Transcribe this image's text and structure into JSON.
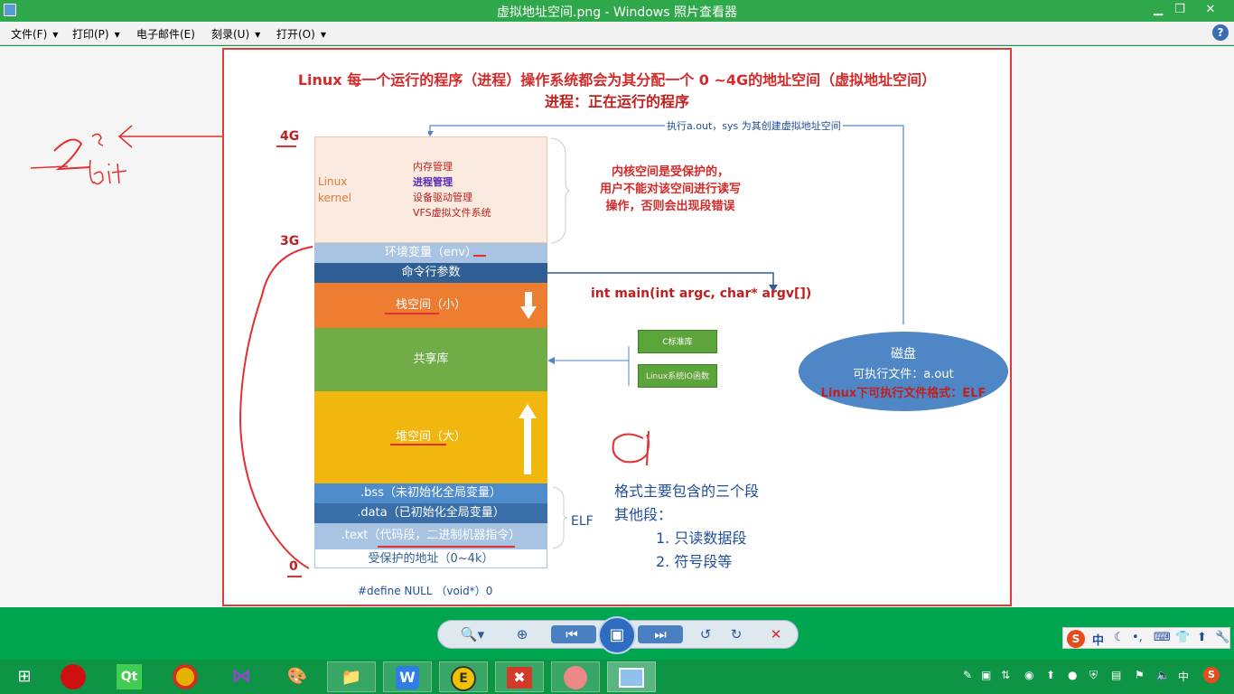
{
  "window": {
    "title": "虚拟地址空间.png - Windows 照片查看器",
    "minimize": "▁",
    "restore": "❐",
    "close": "✕"
  },
  "menu": {
    "items": [
      {
        "label": "文件(F)"
      },
      {
        "label": "打印(P)"
      },
      {
        "label": "电子邮件(E)"
      },
      {
        "label": "刻录(U)"
      },
      {
        "label": "打开(O)"
      }
    ],
    "help": "?"
  },
  "slide": {
    "title1": "Linux 每一个运行的程序（进程）操作系统都会为其分配一个 0 ~4G的地址空间（虚拟地址空间）",
    "title2": "进程：正在运行的程序",
    "exec_note": "执行a.out，sys 为其创建虚拟地址空间",
    "axis": {
      "top": "4G",
      "mid": "3G",
      "bottom": "0"
    },
    "kernel": {
      "label1": "Linux",
      "label2": "kernel",
      "items": [
        "内存管理",
        "进程管理",
        "设备驱动管理",
        "VFS虚拟文件系统"
      ]
    },
    "kernel_note": [
      "内核空间是受保护的，",
      "用户不能对该空间进行读写",
      "操作，否则会出现段错误"
    ],
    "segments": {
      "env": "环境变量（env）",
      "args": "命令行参数",
      "stack": "栈空间（小）",
      "shared": "共享库",
      "heap": "堆空间（大）",
      "bss": ".bss（未初始化全局变量）",
      "data": ".data（已初始化全局变量）",
      "text": ".text（代码段，二进制机器指令）",
      "reserved": "受保护的地址（0~4k）"
    },
    "main_sig": "int main(int argc, char* argv[])",
    "libc": "C标准库",
    "linux_io": "Linux系统IO函数",
    "disk": {
      "line1": "磁盘",
      "line2": "可执行文件：a.out",
      "line3": "Linux下可执行文件格式：ELF"
    },
    "elf_label": "ELF",
    "elf_note": [
      "格式主要包含的三个段",
      "其他段：",
      "1. 只读数据段",
      "2. 符号段等"
    ],
    "define_null": "#define NULL （void*）0"
  },
  "toolbar": {
    "zoom": "🔍▾",
    "fit": "⊕",
    "prev": "⏮",
    "slideshow": "▣",
    "next": "⏭",
    "rotate_left": "↺",
    "rotate_right": "↻",
    "delete": "✕"
  },
  "ime": {
    "text": "中"
  },
  "tray": {
    "lang": "中"
  },
  "colors": {
    "env": "#a9c4e2",
    "args": "#2f5f95",
    "stack": "#ed7d31",
    "shared": "#70ad47",
    "heap": "#f2b70f",
    "bss": "#4f8ccc",
    "data": "#3a6ea8",
    "text": "#a9c4e2",
    "accent": "#e03a3a"
  }
}
